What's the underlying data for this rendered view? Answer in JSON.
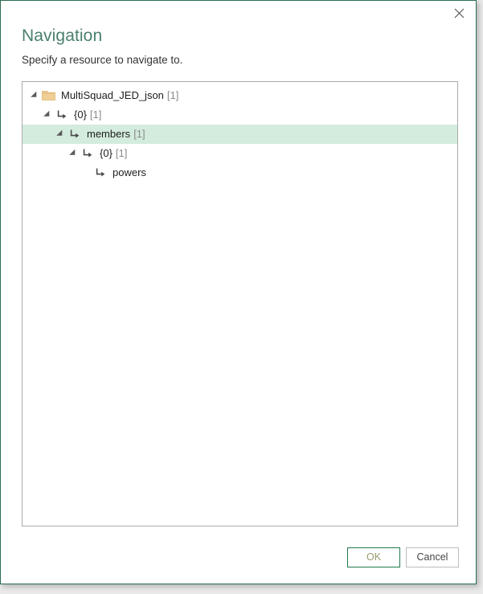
{
  "window": {
    "close_icon": "close-icon",
    "border_color": "#2a6b4f"
  },
  "header": {
    "title": "Navigation",
    "subtitle": "Specify a resource to navigate to.",
    "title_color": "#4a7f6e"
  },
  "tree": {
    "selected_row_color": "#d3ecdd",
    "nodes": [
      {
        "label": "MultiSquad_JED_json",
        "count": "[1]",
        "icon": "folder-icon",
        "depth": 0,
        "expanded": true,
        "has_children": true,
        "selected": false
      },
      {
        "label": "{0}",
        "count": "[1]",
        "icon": "record-arrow-icon",
        "depth": 1,
        "expanded": true,
        "has_children": true,
        "selected": false
      },
      {
        "label": "members",
        "count": "[1]",
        "icon": "record-arrow-icon",
        "depth": 2,
        "expanded": true,
        "has_children": true,
        "selected": true
      },
      {
        "label": "{0}",
        "count": "[1]",
        "icon": "record-arrow-icon",
        "depth": 3,
        "expanded": true,
        "has_children": true,
        "selected": false
      },
      {
        "label": "powers",
        "count": "",
        "icon": "record-arrow-icon",
        "depth": 4,
        "expanded": false,
        "has_children": false,
        "selected": false
      }
    ]
  },
  "footer": {
    "ok_label": "OK",
    "cancel_label": "Cancel"
  }
}
